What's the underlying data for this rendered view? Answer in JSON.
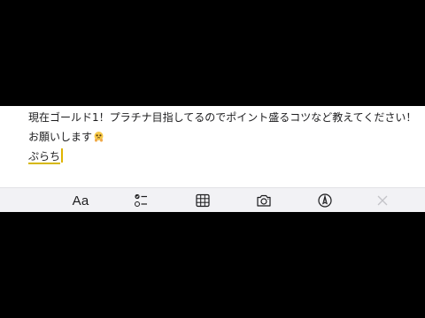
{
  "note": {
    "line1": "現在ゴールド1！プラチナ目指してるのでポイント盛るコツなど教えてください！",
    "line2": "お願いします",
    "line2_emoji": "pleading-hands-emoji",
    "line3": "ぷらち"
  },
  "toolbar": {
    "format_label": "Aa",
    "items": [
      {
        "name": "format-button",
        "icon": "text-format-icon"
      },
      {
        "name": "checklist-button",
        "icon": "checklist-icon"
      },
      {
        "name": "table-button",
        "icon": "table-icon"
      },
      {
        "name": "camera-button",
        "icon": "camera-icon"
      },
      {
        "name": "markup-button",
        "icon": "pen-icon"
      },
      {
        "name": "close-button",
        "icon": "close-icon"
      }
    ]
  },
  "colors": {
    "accent": "#e0b400",
    "text": "#1c1c1e",
    "toolbar_bg": "#f2f2f5",
    "disabled": "#c4c4c8"
  }
}
